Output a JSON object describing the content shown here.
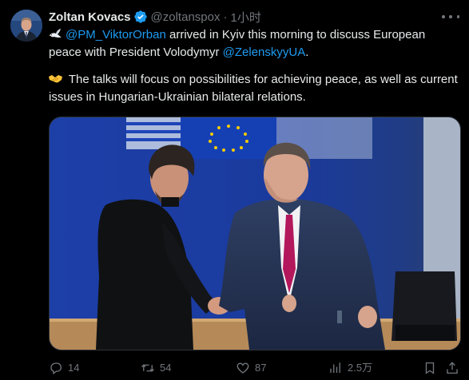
{
  "author": {
    "name": "Zoltan Kovacs",
    "handle": "@zoltanspox",
    "separator": "·",
    "time": "1小时"
  },
  "tweet": {
    "para1_emoji": "dove-emoji",
    "para1_mention1": "@PM_ViktorOrban",
    "para1_text1": " arrived in Kyiv this morning to discuss European peace with President Volodymyr ",
    "para1_mention2": "@ZelenskyyUA",
    "para1_text2": ".",
    "para2_emoji": "handshake-emoji",
    "para2_text": " The talks will focus on possibilities for achieving peace, as well as current issues in Hungarian-Ukrainian bilateral relations."
  },
  "media": {
    "subject": "photo",
    "icon": "photo"
  },
  "actions": {
    "reply": {
      "icon": "reply-icon",
      "count": "14"
    },
    "repost": {
      "icon": "repost-icon",
      "count": "54"
    },
    "like": {
      "icon": "heart-icon",
      "count": "87"
    },
    "views": {
      "icon": "views-icon",
      "count": "2.5万"
    },
    "bookmark": {
      "icon": "bookmark-icon"
    },
    "share": {
      "icon": "share-icon"
    }
  },
  "colors": {
    "background": "#000000",
    "text": "#e7e9ea",
    "muted": "#71767b",
    "link": "#1d9bf0",
    "verified": "#1d9bf0"
  }
}
